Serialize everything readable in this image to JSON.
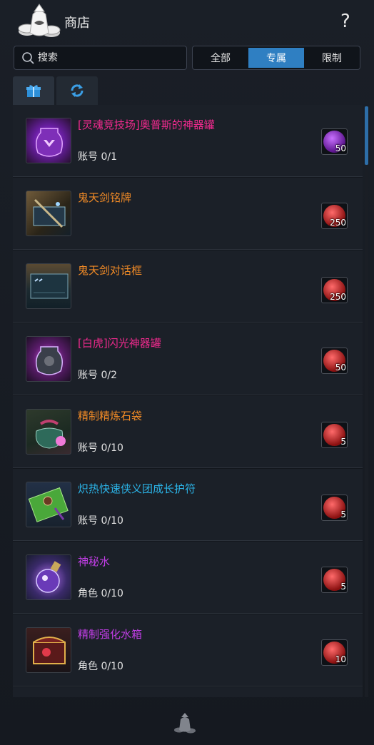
{
  "header": {
    "title": "商店",
    "help_label": "?"
  },
  "search": {
    "placeholder": "搜索",
    "value": ""
  },
  "filters": [
    {
      "label": "全部",
      "active": false
    },
    {
      "label": "专属",
      "active": true
    },
    {
      "label": "限制",
      "active": false
    }
  ],
  "tabs": [
    {
      "icon": "gift-box-icon",
      "active": true
    },
    {
      "icon": "refresh-icon",
      "active": false
    }
  ],
  "colors": {
    "accent": "#2f7fc2",
    "pink": "#f02a8e",
    "orange": "#f08a26",
    "blue": "#2bb4e8",
    "purple": "#c13ee6"
  },
  "items": [
    {
      "name": "[灵魂竞技场]奥普斯的神器罐",
      "limit": "账号 0/1",
      "price": "50",
      "name_color": "pink",
      "currency": "purple-coin-icon",
      "thumb": "purple-jar-icon"
    },
    {
      "name": "鬼天剑铭牌",
      "limit": "",
      "price": "250",
      "name_color": "orange",
      "currency": "red-coin-icon",
      "thumb": "sword-plate-icon"
    },
    {
      "name": "鬼天剑对话框",
      "limit": "",
      "price": "250",
      "name_color": "orange",
      "currency": "red-coin-icon",
      "thumb": "dialog-frame-icon"
    },
    {
      "name": "[白虎]闪光神器罐",
      "limit": "账号 0/2",
      "price": "50",
      "name_color": "pink",
      "currency": "red-coin-icon",
      "thumb": "flash-jar-icon"
    },
    {
      "name": "精制精炼石袋",
      "limit": "账号 0/10",
      "price": "5",
      "name_color": "orange",
      "currency": "red-coin-icon",
      "thumb": "stone-bag-icon"
    },
    {
      "name": "炽热快速侠义团成长护符",
      "limit": "账号 0/10",
      "price": "5",
      "name_color": "blue",
      "currency": "red-coin-icon",
      "thumb": "charm-icon"
    },
    {
      "name": "神秘水",
      "limit": "角色 0/10",
      "price": "5",
      "name_color": "purple",
      "currency": "red-coin-icon",
      "thumb": "mystic-water-icon"
    },
    {
      "name": "精制强化水箱",
      "limit": "角色 0/10",
      "price": "10",
      "name_color": "purple",
      "currency": "red-coin-icon",
      "thumb": "water-chest-icon"
    }
  ]
}
